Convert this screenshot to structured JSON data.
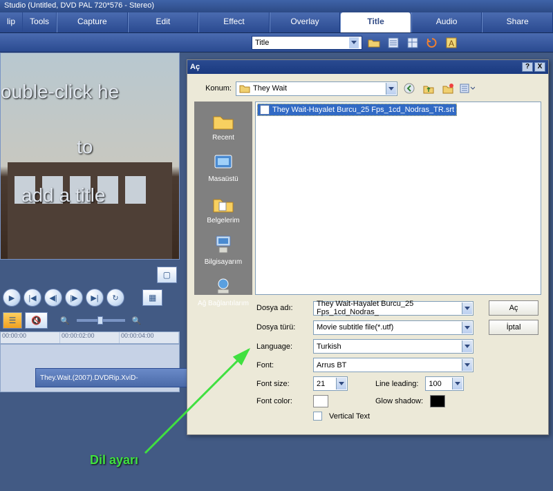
{
  "titlebar": "Studio (Untitled, DVD PAL 720*576 - Stereo)",
  "menubar": {
    "clip": "lip",
    "tools": "Tools"
  },
  "tabs": {
    "capture": "Capture",
    "edit": "Edit",
    "effect": "Effect",
    "overlay": "Overlay",
    "title": "Title",
    "audio": "Audio",
    "share": "Share"
  },
  "toolbar": {
    "combo_label": "Title"
  },
  "preview": {
    "line1": "ouble-click he",
    "line2": "to",
    "line3": "add a title"
  },
  "ruler": {
    "t0": "00:00:00",
    "t1": "00:00:02:00",
    "t2": "00:00:04:00"
  },
  "clip": "They.Wait.(2007).DVDRip.XviD-",
  "dialog": {
    "title": "Aç",
    "help": "?",
    "close": "X",
    "konum_label": "Konum:",
    "konum_value": "They Wait",
    "selected_file": "They Wait-Hayalet Burcu_25 Fps_1cd_Nodras_TR.srt",
    "places": {
      "recent": "Recent",
      "desktop": "Masaüstü",
      "docs": "Belgelerim",
      "computer": "Bilgisayarım",
      "network": "Ağ Bağlantılarım"
    },
    "dosya_adi_label": "Dosya adı:",
    "dosya_adi": "They Wait-Hayalet Burcu_25 Fps_1cd_Nodras_",
    "dosya_turu_label": "Dosya türü:",
    "dosya_turu": "Movie subtitle file(*.utf)",
    "open_btn": "Aç",
    "cancel_btn": "İptal",
    "language_label": "Language:",
    "language": "Turkish",
    "font_label": "Font:",
    "font": "Arrus BT",
    "font_size_label": "Font size:",
    "font_size": "21",
    "line_leading_label": "Line leading:",
    "line_leading": "100",
    "font_color_label": "Font color:",
    "glow_shadow_label": "Glow shadow:",
    "vertical_text": "Vertical Text"
  },
  "annotation": "Dil ayarı"
}
